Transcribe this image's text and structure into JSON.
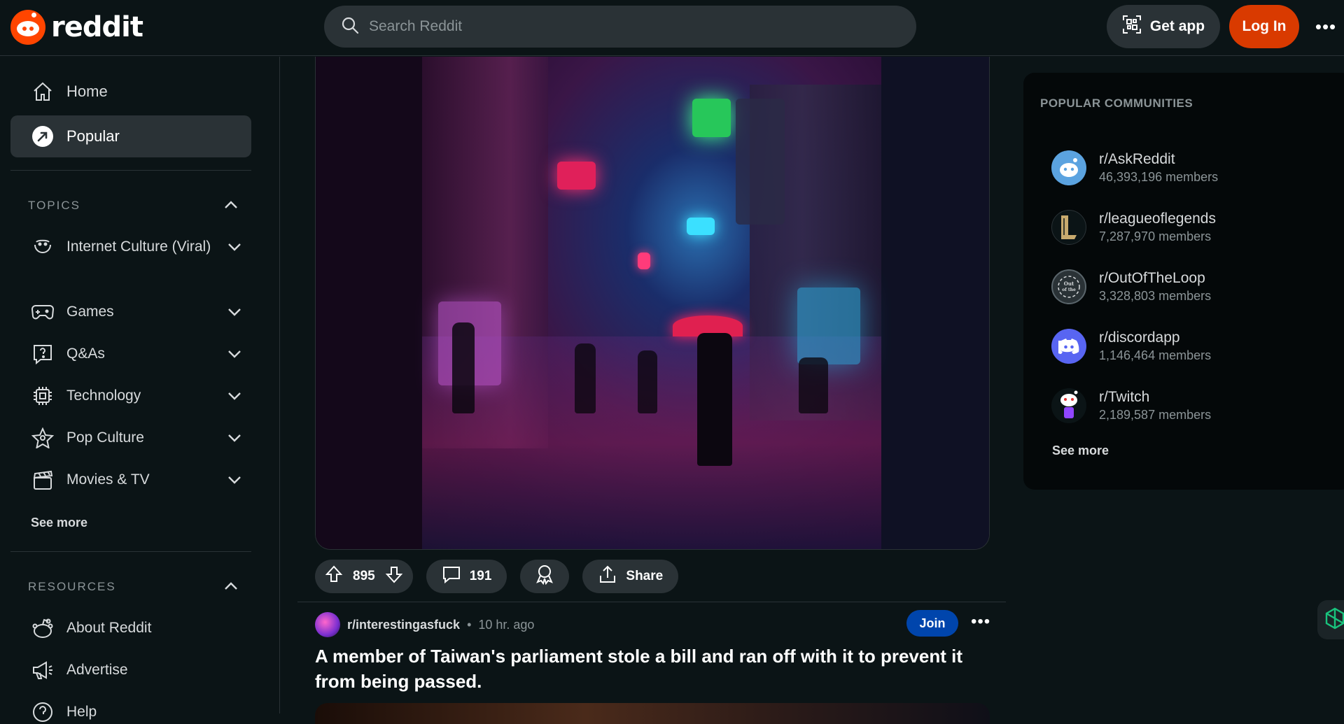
{
  "header": {
    "logo_text": "reddit",
    "search_placeholder": "Search Reddit",
    "get_app_label": "Get app",
    "login_label": "Log In"
  },
  "sidebar": {
    "nav": [
      {
        "label": "Home",
        "icon": "home-icon"
      },
      {
        "label": "Popular",
        "icon": "popular-icon",
        "active": true
      }
    ],
    "topics_heading": "TOPICS",
    "topics": [
      {
        "label": "Internet Culture (Viral)",
        "icon": "smile-icon"
      },
      {
        "label": "Games",
        "icon": "gamepad-icon"
      },
      {
        "label": "Q&As",
        "icon": "question-icon"
      },
      {
        "label": "Technology",
        "icon": "chip-icon"
      },
      {
        "label": "Pop Culture",
        "icon": "star-icon"
      },
      {
        "label": "Movies & TV",
        "icon": "clapper-icon"
      }
    ],
    "topics_see_more": "See more",
    "resources_heading": "RESOURCES",
    "resources": [
      {
        "label": "About Reddit",
        "icon": "reddit-alien-icon"
      },
      {
        "label": "Advertise",
        "icon": "megaphone-icon"
      },
      {
        "label": "Help",
        "icon": "help-icon"
      }
    ]
  },
  "post": {
    "votes": "895",
    "comments": "191",
    "share_label": "Share"
  },
  "next_post": {
    "subreddit": "r/interestingasfuck",
    "time": "10 hr. ago",
    "join_label": "Join",
    "title": "A member of Taiwan's parliament stole a bill and ran off with it to prevent it from being passed."
  },
  "popular_communities": {
    "title": "POPULAR COMMUNITIES",
    "items": [
      {
        "name": "r/AskReddit",
        "members": "46,393,196 members",
        "color": "#5ba3e0"
      },
      {
        "name": "r/leagueoflegends",
        "members": "7,287,970 members",
        "color": "#c8aa6e"
      },
      {
        "name": "r/OutOfTheLoop",
        "members": "3,328,803 members",
        "color": "#3a4550"
      },
      {
        "name": "r/discordapp",
        "members": "1,146,464 members",
        "color": "#5865f2"
      },
      {
        "name": "r/Twitch",
        "members": "2,189,587 members",
        "color": "#9146ff"
      }
    ],
    "see_more": "See more"
  },
  "colors": {
    "background": "#0b1416",
    "accent": "#d93a00",
    "join": "#0045ac"
  }
}
